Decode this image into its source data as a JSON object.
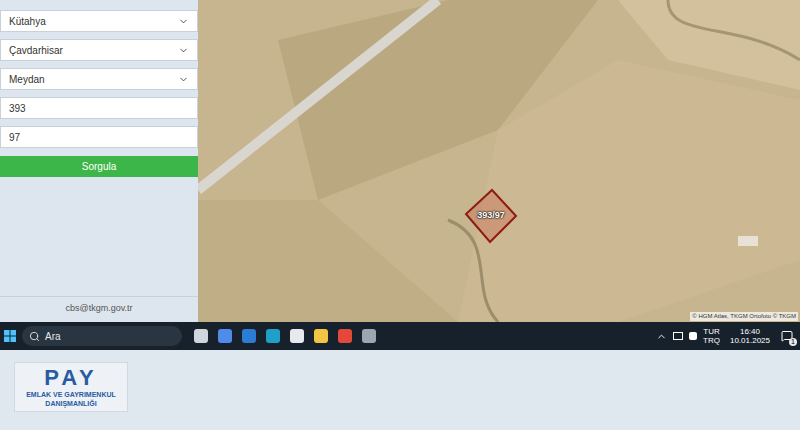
{
  "sidebar": {
    "fields": [
      {
        "kind": "select",
        "value": "Kütahya"
      },
      {
        "kind": "select",
        "value": "Çavdarhisar"
      },
      {
        "kind": "select",
        "value": "Meydan"
      },
      {
        "kind": "input",
        "value": "393"
      },
      {
        "kind": "input",
        "value": "97"
      }
    ],
    "button": "Sorgula",
    "email": "cbs@tkgm.gov.tr"
  },
  "map": {
    "parcel_label": "393/97",
    "attribution": "© HGM Atlas, TKGM Ortofoto © TKGM"
  },
  "taskbar": {
    "search_placeholder": "Ara",
    "language": [
      "TUR",
      "TRQ"
    ],
    "time": "16:40",
    "date": "10.01.2025",
    "notifications": "1"
  },
  "logo": {
    "name": "PAY",
    "line1": "EMLAK VE GAYRIMENKUL",
    "line2": "DANIŞMANLIĞI"
  }
}
